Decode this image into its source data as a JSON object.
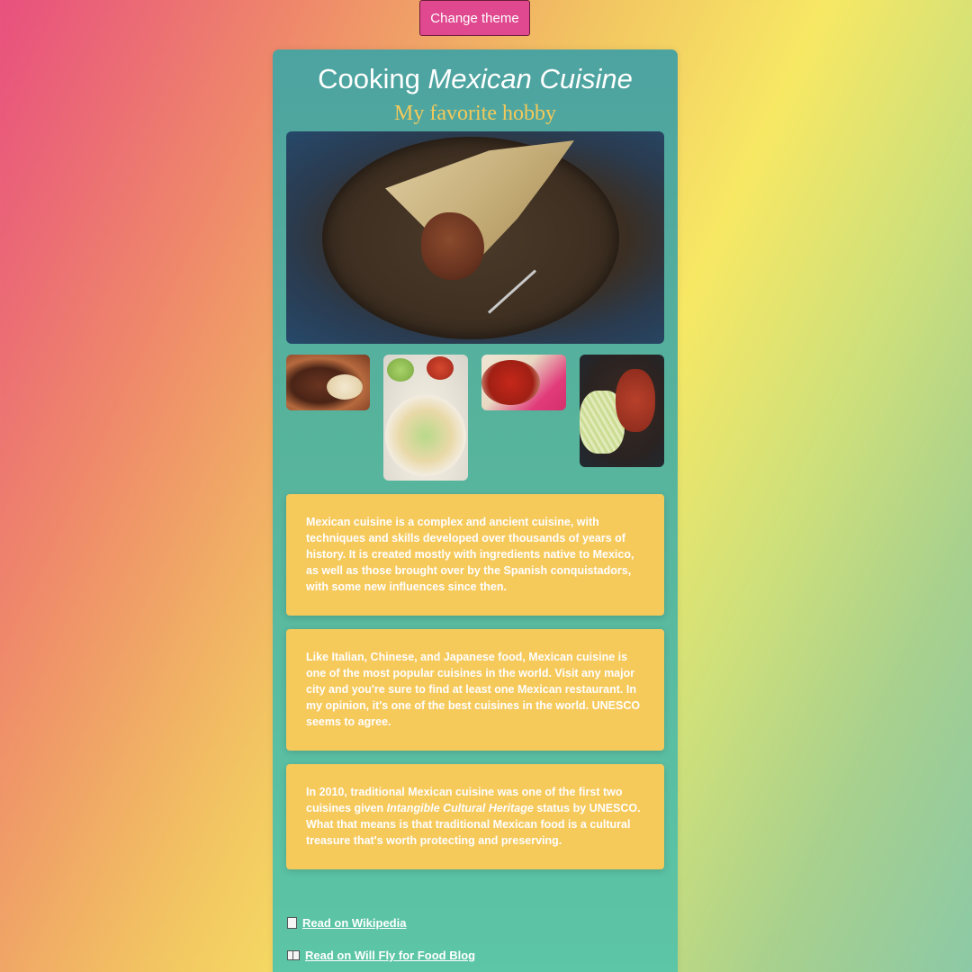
{
  "theme_button": {
    "label": "Change theme"
  },
  "header": {
    "title_prefix": "Cooking ",
    "title_emphasis": "Mexican Cuisine",
    "subtitle": "My favorite hobby"
  },
  "gallery": {
    "hero": "tamale-photo",
    "thumbnails": [
      "mole-and-rice-photo",
      "flautas-photo",
      "pozole-photo",
      "enchiladas-photo"
    ]
  },
  "paragraphs": [
    {
      "text": "Mexican cuisine is a complex and ancient cuisine, with techniques and skills developed over thousands of years of history. It is created mostly with ingredients native to Mexico, as well as those brought over by the Spanish conquistadors, with some new influences since then."
    },
    {
      "text": "Like Italian, Chinese, and Japanese food, Mexican cuisine is one of the most popular cuisines in the world. Visit any major city and you're sure to find at least one Mexican restaurant. In my opinion, it's one of the best cuisines in the world. UNESCO seems to agree."
    },
    {
      "text_before": "In 2010, traditional Mexican cuisine was one of the first two cuisines given ",
      "text_emphasis": "Intangible Cultural Heritage",
      "text_after": " status by UNESCO. What that means is that traditional Mexican food is a cultural treasure that's worth protecting and preserving."
    }
  ],
  "links": [
    {
      "icon": "page-icon",
      "label": "Read on Wikipedia"
    },
    {
      "icon": "book-icon",
      "label": "Read on Will Fly for Food Blog"
    }
  ],
  "colors": {
    "button": "#e0488f",
    "card": "#57b39c",
    "text_box": "#f6c95b",
    "subtitle": "#f4c95a"
  }
}
